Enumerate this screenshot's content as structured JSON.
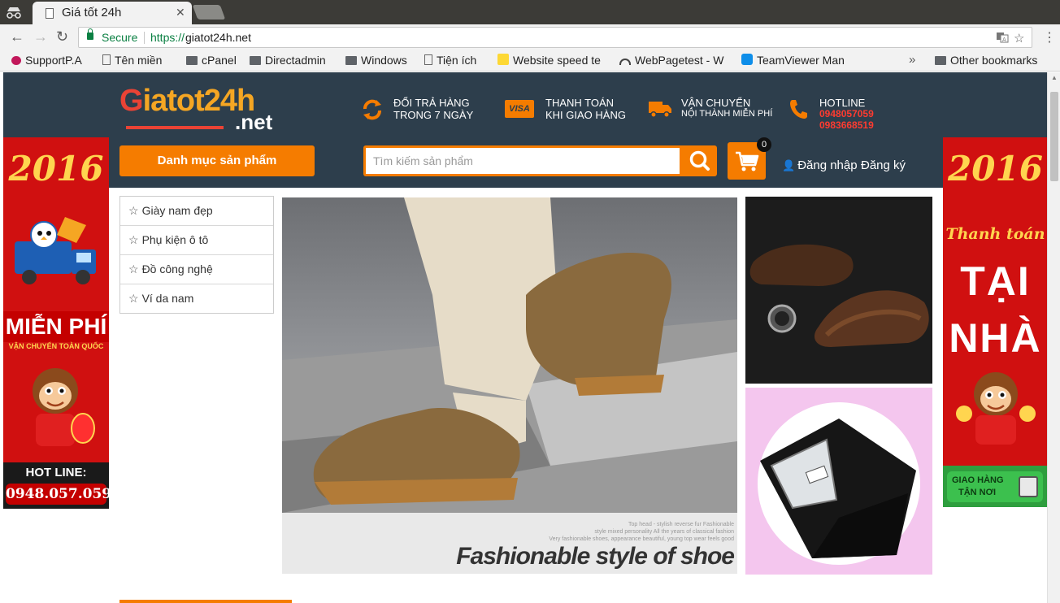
{
  "browser": {
    "tab_title": "Giá tốt 24h",
    "omnibox": {
      "secure_label": "Secure",
      "url_scheme": "https://",
      "url_host": "giatot24h.net"
    },
    "bookmarks": [
      {
        "label": "SupportP.A",
        "icon": "support-icon"
      },
      {
        "label": "Tên miền",
        "icon": "doc-icon"
      },
      {
        "label": "cPanel",
        "icon": "folder-icon"
      },
      {
        "label": "Directadmin",
        "icon": "folder-icon"
      },
      {
        "label": "Windows",
        "icon": "folder-icon"
      },
      {
        "label": "Tiện ích",
        "icon": "doc-icon"
      },
      {
        "label": "Website speed te",
        "icon": "pagespeed-icon"
      },
      {
        "label": "WebPagetest - W",
        "icon": "gauge-icon"
      },
      {
        "label": "TeamViewer Man",
        "icon": "teamviewer-icon"
      }
    ],
    "more_bookmarks": "»",
    "other_bookmarks": "Other bookmarks"
  },
  "header": {
    "logo": {
      "main_g": "G",
      "main_rest": "iatot24h",
      "net": ".net"
    },
    "features": [
      {
        "line1": "ĐỔI TRẢ HÀNG",
        "line2": "TRONG 7 NGÀY",
        "icon": "refresh-icon"
      },
      {
        "line1": "THANH TOÁN",
        "line2": "KHI GIAO HÀNG",
        "icon": "visa-card-icon",
        "icon_text": "VISA"
      },
      {
        "line1": "VẬN CHUYỂN",
        "line2": "NỘI THÀNH MIỄN PHÍ",
        "icon": "truck-icon"
      },
      {
        "line1": "HOTLINE",
        "phones": [
          "0948057059",
          "0983668519"
        ],
        "icon": "phone-icon"
      }
    ],
    "category_button": "Danh mục sản phẩm",
    "search_placeholder": "Tìm kiếm sản phẩm",
    "cart_count": "0",
    "login": "Đăng nhập",
    "register": "Đăng ký"
  },
  "categories": [
    "Giày nam đẹp",
    "Phụ kiện ô tô",
    "Đồ công nghệ",
    "Ví da nam"
  ],
  "hero": {
    "small_text": [
      "Top head - stylish reverse fur Fashionable",
      "style mixed personality All the years of classical fashion",
      "Very fashionable shoes, appearance beautiful, young top wear feels good"
    ],
    "caption": "Fashionable style of shoe"
  },
  "left_banner": {
    "year": "2016",
    "line1": "MIỄN PHÍ",
    "line2": "VẬN CHUYỂN TOÀN QUỐC",
    "hotline_label": "HOT LINE:",
    "hotline_number": "0948.057.059"
  },
  "right_banner": {
    "year": "2016",
    "line1": "Thanh toán",
    "line2": "TẠI",
    "line3": "NHÀ",
    "footer1": "GIAO HÀNG",
    "footer2": "TẬN NƠI"
  },
  "colors": {
    "accent": "#f57c00",
    "header_bg": "#2d3e4c",
    "hotline": "#ff3b30",
    "banner_red": "#d01010"
  }
}
